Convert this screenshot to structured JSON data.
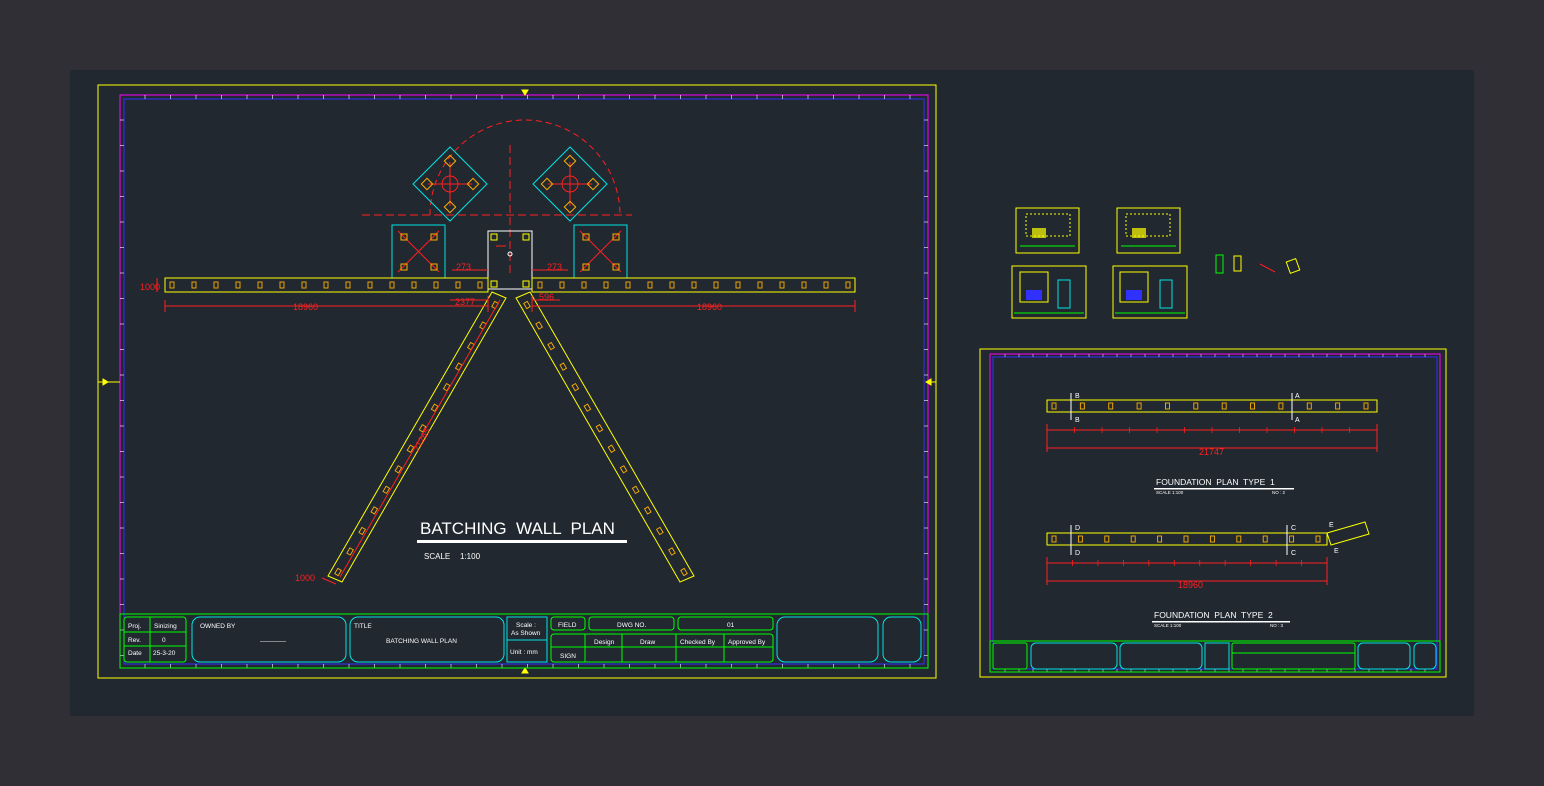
{
  "colors": {
    "viewport": "#302f35",
    "model_space": "#212830",
    "sheet_border": "#ffff00",
    "inner_border_magenta": "#ff00ff",
    "inner_border_blue": "#3030ff",
    "wall": "#ffff00",
    "dimension": "#ff2020",
    "cyan": "#00e5e5",
    "green": "#00ff00",
    "white": "#ffffff",
    "orange": "#ffb000"
  },
  "main_sheet": {
    "title": "BATCHING  WALL  PLAN",
    "scale_label": "SCALE",
    "scale_value": "1:100",
    "dims": {
      "left_height": "1000",
      "left_span": "18960",
      "right_span": "18960",
      "gap_left_top": "273",
      "gap_right_top": "273",
      "gap_left_bottom": "2377",
      "gap_right_bottom": "596",
      "diagonal": "21265",
      "diag_width": "1000"
    },
    "title_block": {
      "proj_label": "Proj.",
      "proj_value": "Sinizing",
      "rev_label": "Rev.",
      "rev_value": "0",
      "date_label": "Date",
      "date_value": "25-3-20",
      "owner_label": "OWNED BY",
      "owner_value": "————",
      "title_label": "TITLE",
      "title_value": "BATCHING WALL PLAN",
      "scale_label": "Scale :",
      "scale_value": "As Shown",
      "unit_label": "Unit : mm",
      "field": "FIELD",
      "dwg_label": "DWG NO.",
      "dwg_value": "01",
      "design": "Design",
      "draw": "Draw",
      "checked": "Checked By",
      "approved": "Approved By",
      "sign": "SIGN"
    }
  },
  "second_sheet": {
    "plan1_title": "FOUNDATION  PLAN  TYPE  1",
    "plan1_scale": "SCALE  1:100",
    "plan1_no": "NO : 2",
    "plan1_dim": "21747",
    "plan2_title": "FOUNDATION  PLAN  TYPE  2",
    "plan2_scale": "SCALE  1:100",
    "plan2_no": "NO : 3",
    "plan2_dim": "18960",
    "marks": {
      "a": "A",
      "b": "B",
      "c": "C",
      "d": "D",
      "e": "E"
    }
  }
}
